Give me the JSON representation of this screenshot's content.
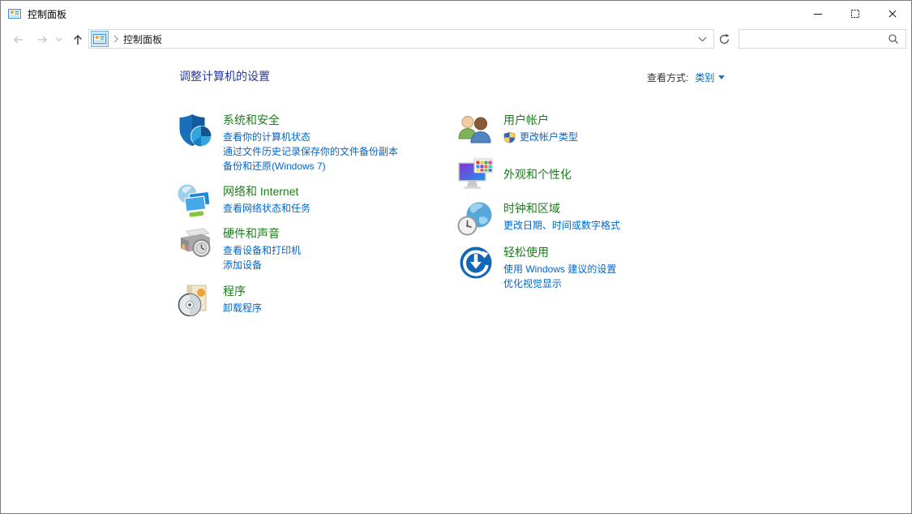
{
  "window": {
    "title": "控制面板",
    "controls": [
      "minimize-icon",
      "maximize-icon",
      "close-icon"
    ]
  },
  "navbar": {
    "back_icon": "back-arrow-icon",
    "forward_icon": "forward-arrow-icon",
    "recent_pages_icon": "chevron-down-icon",
    "up_icon": "up-arrow-icon",
    "address_icon": "control-panel-icon",
    "address": "控制面板",
    "address_dropdown_icon": "chevron-down-icon",
    "refresh_icon": "refresh-icon"
  },
  "search": {
    "value": "",
    "icon": "search-icon"
  },
  "page": {
    "heading": "调整计算机的设置",
    "view_by_label": "查看方式:",
    "view_by_value": "类别"
  },
  "categories": {
    "left": [
      {
        "title": "系统和安全",
        "icon": "system-security-icon",
        "links": [
          "查看你的计算机状态",
          "通过文件历史记录保存你的文件备份副本",
          "备份和还原(Windows 7)"
        ]
      },
      {
        "title": "网络和 Internet",
        "icon": "network-internet-icon",
        "links": [
          "查看网络状态和任务"
        ]
      },
      {
        "title": "硬件和声音",
        "icon": "hardware-sound-icon",
        "links": [
          "查看设备和打印机",
          "添加设备"
        ]
      },
      {
        "title": "程序",
        "icon": "programs-icon",
        "links": [
          "卸载程序"
        ]
      }
    ],
    "right": [
      {
        "title": "用户帐户",
        "icon": "user-accounts-icon",
        "links": [
          "更改帐户类型"
        ],
        "link_shield_icon": "uac-shield-icon"
      },
      {
        "title": "外观和个性化",
        "icon": "appearance-personalization-icon",
        "links": []
      },
      {
        "title": "时钟和区域",
        "icon": "clock-region-icon",
        "links": [
          "更改日期、时间或数字格式"
        ]
      },
      {
        "title": "轻松使用",
        "icon": "ease-of-access-icon",
        "links": [
          "使用 Windows 建议的设置",
          "优化视觉显示"
        ]
      }
    ]
  },
  "colors": {
    "category_title": "#1c7c1c",
    "task_link": "#0066cc",
    "page_heading": "#2838a3",
    "view_by_link": "#0066cc",
    "window_border": "#7b7b7b"
  }
}
